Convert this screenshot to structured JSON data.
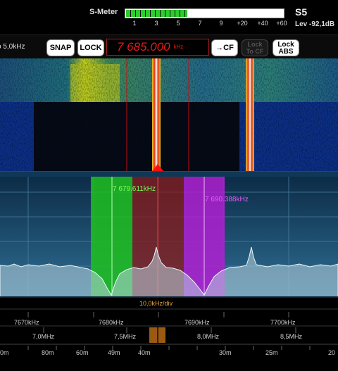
{
  "smeter": {
    "title": "S-Meter",
    "ticks": [
      "1",
      "3",
      "5",
      "7",
      "9",
      "+20",
      "+40",
      "+60"
    ],
    "level_fraction": 0.39,
    "s_reading": "S5",
    "level": "Lev -92,1dB"
  },
  "toolbar": {
    "span": "o 5,0kHz",
    "snap": "SNAP",
    "lock": "LOCK",
    "frequency": "7 685.000",
    "frequency_unit": "kHz",
    "to_cf": "→CF",
    "lock_to_cf_line1": "Lock",
    "lock_to_cf_line2": "To CF",
    "lock_abs_line1": "Lock",
    "lock_abs_line2": "ABS"
  },
  "spectrum": {
    "green_marker": "7 679.611kHz",
    "magenta_marker": "7 690.388kHz",
    "div": "10,0kHz/div"
  },
  "scale": {
    "khz_labels": [
      "7670kHz",
      "7680kHz",
      "7690kHz",
      "7700kHz"
    ],
    "mhz_labels": [
      "7,0MHz",
      "7,5MHz",
      "8,0MHz",
      "8,5MHz"
    ],
    "band_labels": [
      "0m",
      "80m",
      "60m",
      "49m",
      "40m",
      "30m",
      "25m",
      "20"
    ]
  },
  "colors": {
    "green_band": "#1fbf1f",
    "magenta_band": "#b01fd1",
    "red_band": "#8a1a1a",
    "frequency_text": "#e31b1b"
  }
}
